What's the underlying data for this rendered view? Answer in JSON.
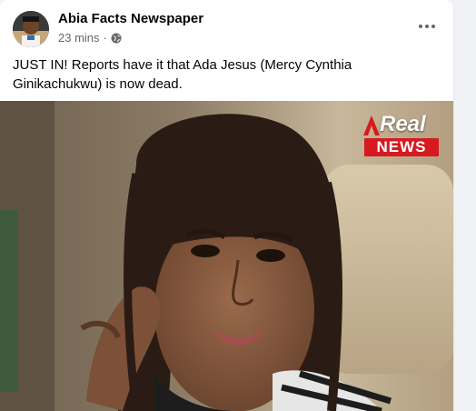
{
  "post": {
    "author": "Abia Facts Newspaper",
    "time": "23 mins",
    "separator": "·",
    "privacy_icon": "globe-icon",
    "more_icon": "more-horizontal-icon",
    "text": "JUST IN! Reports have it that Ada Jesus (Mercy Cynthia Ginikachukwu) is now dead."
  },
  "image": {
    "watermark_real": "Real",
    "watermark_news": "NEWS"
  },
  "colors": {
    "author": "#050505",
    "meta": "#65676b",
    "news_red": "#d71920"
  }
}
